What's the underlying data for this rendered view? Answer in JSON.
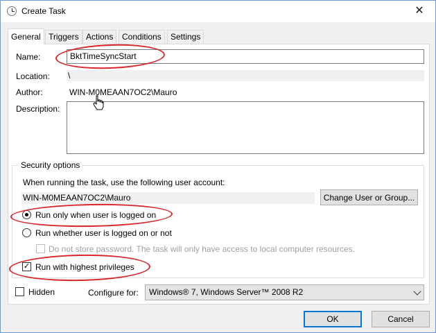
{
  "window": {
    "title": "Create Task",
    "close_glyph": "✕"
  },
  "tabs": [
    {
      "label": "General",
      "active": true
    },
    {
      "label": "Triggers",
      "active": false
    },
    {
      "label": "Actions",
      "active": false
    },
    {
      "label": "Conditions",
      "active": false
    },
    {
      "label": "Settings",
      "active": false
    }
  ],
  "general": {
    "name_label": "Name:",
    "name_value": "BktTimeSyncStart",
    "location_label": "Location:",
    "location_value": "\\",
    "author_label": "Author:",
    "author_value": "WIN-M0MEAAN7OC2\\Mauro",
    "description_label": "Description:",
    "description_value": ""
  },
  "security": {
    "title": "Security options",
    "account_prompt": "When running the task, use the following user account:",
    "account_value": "WIN-M0MEAAN7OC2\\Mauro",
    "change_button": "Change User or Group...",
    "radio_logged_on": "Run only when user is logged on",
    "radio_whether": "Run whether user is logged on or not",
    "do_not_store": "Do not store password.  The task will only have access to local computer resources.",
    "highest_privileges": "Run with highest privileges",
    "selected_radio": "logged_on",
    "highest_checked": true
  },
  "footer": {
    "hidden_label": "Hidden",
    "configure_label": "Configure for:",
    "configure_value": "Windows® 7, Windows Server™ 2008 R2",
    "ok_label": "OK",
    "cancel_label": "Cancel"
  },
  "colors": {
    "annotation": "#d8262a",
    "accent": "#0078d7"
  },
  "icons": {
    "title": "task-scheduler-clock-icon",
    "cursor": "hand-pointer-icon"
  }
}
